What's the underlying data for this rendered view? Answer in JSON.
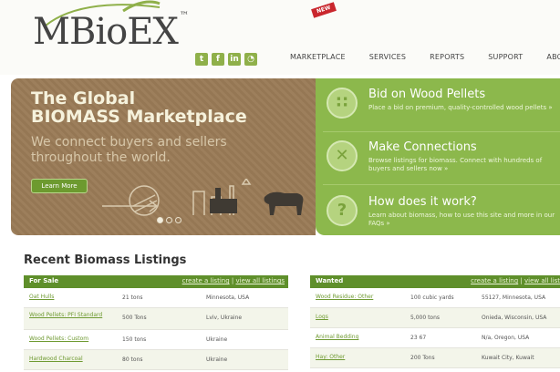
{
  "header": {
    "logo_text": "MBioEX",
    "logo_tm": "™",
    "social": [
      {
        "icon": "twitter-icon",
        "glyph": "t"
      },
      {
        "icon": "facebook-icon",
        "glyph": "f"
      },
      {
        "icon": "linkedin-icon",
        "glyph": "in"
      },
      {
        "icon": "rss-icon",
        "glyph": "◔"
      }
    ],
    "nav": [
      "MARKETPLACE",
      "SERVICES",
      "REPORTS",
      "SUPPORT",
      "ABOUT"
    ]
  },
  "hero": {
    "title_line1": "The Global",
    "title_line2": "BIOMASS Marketplace",
    "subtitle_line1": "We connect buyers and sellers",
    "subtitle_line2": "throughout the world.",
    "learn_more": "Learn More",
    "new_badge": "NEW",
    "features": [
      {
        "title": "Bid on Wood Pellets",
        "desc": "Place a bid on premium, quality-controlled wood pellets »",
        "icon": "pellets-icon",
        "glyph": "∷"
      },
      {
        "title": "Make Connections",
        "desc": "Browse listings for biomass. Connect with hundreds of buyers and sellers now »",
        "icon": "connections-icon",
        "glyph": "✕"
      },
      {
        "title": "How does it work?",
        "desc": "Learn about biomass, how to use this site and more in our FAQs »",
        "icon": "question-icon",
        "glyph": "?"
      }
    ]
  },
  "listings": {
    "title": "Recent Biomass Listings",
    "for_sale": {
      "header": "For Sale",
      "create_link": "create a listing",
      "sep": "|",
      "view_link": "view all listings",
      "rows": [
        {
          "name": "Oat Hulls",
          "qty": "21 tons",
          "location": "Minnesota, USA"
        },
        {
          "name": "Wood Pellets: PFI Standard",
          "qty": "500 Tons",
          "location": "Lviv, Ukraine"
        },
        {
          "name": "Wood Pellets: Custom",
          "qty": "150 tons",
          "location": "Ukraine"
        },
        {
          "name": "Hardwood Charcoal",
          "qty": "80 tons",
          "location": "Ukraine"
        }
      ]
    },
    "wanted": {
      "header": "Wanted",
      "create_link": "create a listing",
      "sep": "|",
      "view_link": "view all listi",
      "rows": [
        {
          "name": "Wood Residue: Other",
          "qty": "100 cubic yards",
          "location": "55127, Minnesota, USA"
        },
        {
          "name": "Logs",
          "qty": "5,000 tons",
          "location": "Onieda, Wisconsin, USA"
        },
        {
          "name": "Animal Bedding",
          "qty": "23 67",
          "location": "N/a, Oregon, USA"
        },
        {
          "name": "Hay: Other",
          "qty": "200 Tons",
          "location": "Kuwait City, Kuwait"
        }
      ]
    }
  },
  "colors": {
    "brand_green": "#8cb84c",
    "table_header_green": "#5f8f2b",
    "hero_brown": "#9a7b57",
    "link_green": "#6f9a32"
  }
}
